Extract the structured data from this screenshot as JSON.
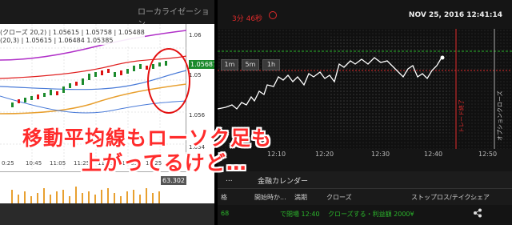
{
  "left_panel": {
    "title": "ローカライゼーション",
    "ma_legend": [
      "(クローズ 20,2) | 1.05615 | 1.05758 | 1.05488",
      "(20,3) | 1.05615 | 1.06484 1.05385"
    ],
    "price_tag": "1.05687",
    "scale_ticks": [
      "1.06",
      "1.05",
      "1.056",
      "1.054"
    ],
    "time_labels": [
      "0:25",
      "10:45",
      "11:05",
      "11:25",
      "11:45",
      "12:05",
      "12:25"
    ],
    "volume_value": "63.302"
  },
  "right_panel": {
    "countdown": "3分 46秒",
    "datetime": "NOV 25, 2016 12:41:14",
    "timeframes": [
      "1m",
      "5m",
      "1h"
    ],
    "vertical_labels": [
      "トレード終了",
      "オプションクローズ"
    ],
    "time_labels": [
      "12:10",
      "12:20",
      "12:30",
      "12:40",
      "12:50"
    ],
    "tabs": [
      "...",
      "金融カレンダー"
    ],
    "table_headers": [
      "格",
      "開始時か...",
      "満期",
      "クローズ",
      "ストップロス/テイク...",
      "シェア"
    ],
    "row": {
      "id": "68",
      "expiry": "で閉場 12:40",
      "status": "クローズする・利益額 2000¥"
    }
  },
  "caption": {
    "line1": "移動平均線もローソク足も",
    "line2": "上がってるけど…"
  },
  "colors": {
    "caption_red": "#ff2b2b",
    "up_candle": "#1b8a2c",
    "down_candle": "#d11",
    "ma_purple": "#b030c8",
    "ma_red": "#e02020",
    "ma_orange": "#e8a030",
    "ma_blue": "#4a7bd8",
    "line_white": "#ffffff",
    "green_dash": "#2bb52b",
    "red_line": "#e02b2b"
  },
  "icons": [
    "clock-icon",
    "share-icon"
  ]
}
